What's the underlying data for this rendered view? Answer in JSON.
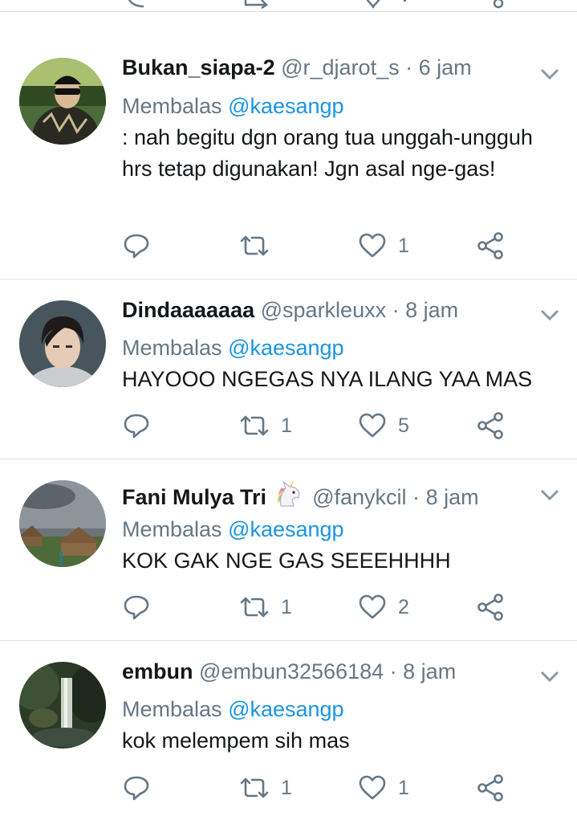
{
  "colors": {
    "accent": "#1b95e0",
    "muted": "#657786",
    "text": "#14171a",
    "divider": "#dfe3e7"
  },
  "tweets": [
    {
      "name": "Bukan_siapa-2",
      "handle": "@r_djarot_s",
      "dot": "·",
      "time": "6 jam",
      "reply_prefix": "Membalas",
      "reply_to": "@kaesangp",
      "text": ": nah begitu dgn orang tua unggah-ungguh hrs tetap digunakan! Jgn asal nge-gas!",
      "replies": "",
      "retweets": "",
      "likes": "1",
      "avatar_icon": "person-avatar"
    },
    {
      "name": "Dindaaaaaaa",
      "handle": "@sparkleuxx",
      "dot": "·",
      "time": "8 jam",
      "reply_prefix": "Membalas",
      "reply_to": "@kaesangp",
      "text": "HAYOOO NGEGAS NYA ILANG YAA MAS",
      "replies": "",
      "retweets": "1",
      "likes": "5",
      "avatar_icon": "person-avatar"
    },
    {
      "name": "Fani Mulya Tri",
      "handle": "@fanykcil",
      "dot": "·",
      "time": "8 jam",
      "reply_prefix": "Membalas",
      "reply_to": "@kaesangp",
      "text": "KOK GAK NGE GAS SEEEHHHH",
      "replies": "",
      "retweets": "1",
      "likes": "2",
      "avatar_icon": "landscape-avatar",
      "name_emoji": "unicorn-icon"
    },
    {
      "name": "embun",
      "handle": "@embun32566184",
      "dot": "·",
      "time": "8 jam",
      "reply_prefix": "Membalas",
      "reply_to": "@kaesangp",
      "text": "kok melempem sih mas",
      "replies": "",
      "retweets": "1",
      "likes": "1",
      "avatar_icon": "waterfall-avatar"
    }
  ]
}
